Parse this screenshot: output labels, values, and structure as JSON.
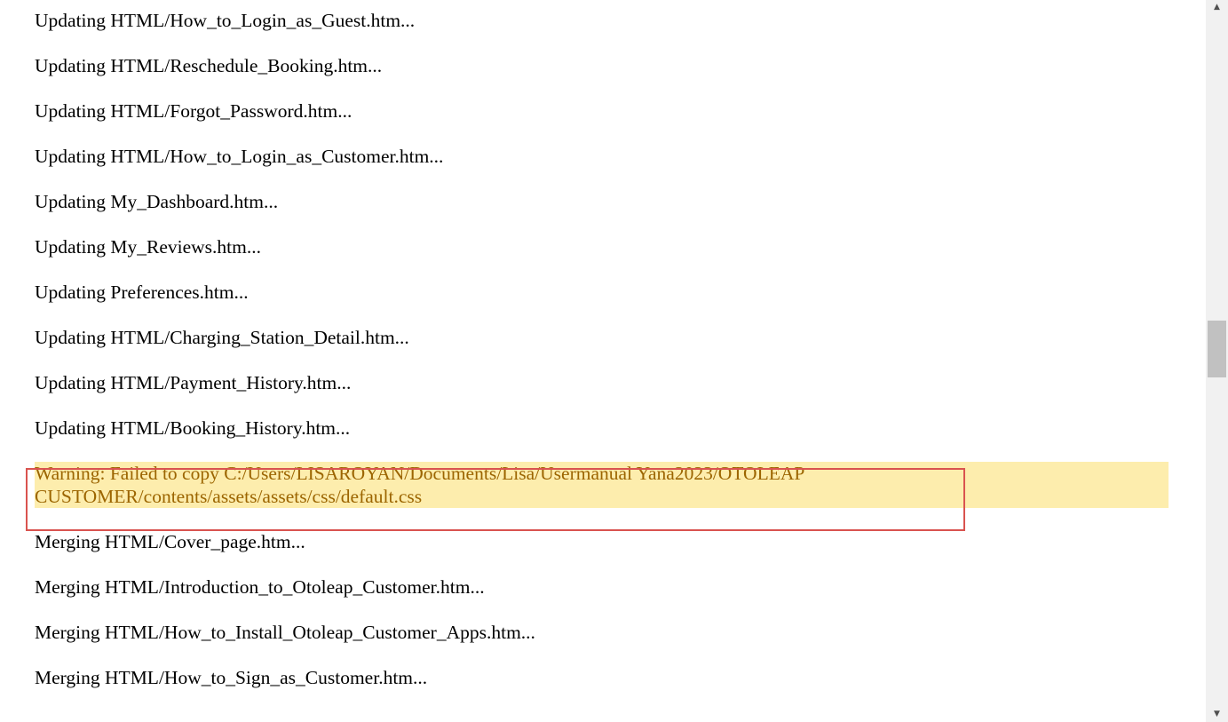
{
  "log": {
    "lines": [
      "Updating HTML/How_to_Login_as_Guest.htm...",
      "Updating HTML/Reschedule_Booking.htm...",
      "Updating HTML/Forgot_Password.htm...",
      "Updating HTML/How_to_Login_as_Customer.htm...",
      "Updating My_Dashboard.htm...",
      "Updating My_Reviews.htm...",
      "Updating Preferences.htm...",
      "Updating HTML/Charging_Station_Detail.htm...",
      "Updating HTML/Payment_History.htm...",
      "Updating HTML/Booking_History.htm...",
      "Warning: Failed to copy C:/Users/LISAROYAN/Documents/Lisa/Usermanual Yana2023/OTOLEAP CUSTOMER/contents/assets/assets/css/default.css",
      "Merging HTML/Cover_page.htm...",
      "Merging HTML/Introduction_to_Otoleap_Customer.htm...",
      "Merging HTML/How_to_Install_Otoleap_Customer_Apps.htm...",
      "Merging HTML/How_to_Sign_as_Customer.htm..."
    ]
  },
  "colors": {
    "warning_bg": "#fdedad",
    "warning_text": "#9c6500",
    "highlight_border": "#d9534f"
  },
  "scrollbar": {
    "up_icon": "triangle-up-icon",
    "down_icon": "triangle-down-icon"
  }
}
